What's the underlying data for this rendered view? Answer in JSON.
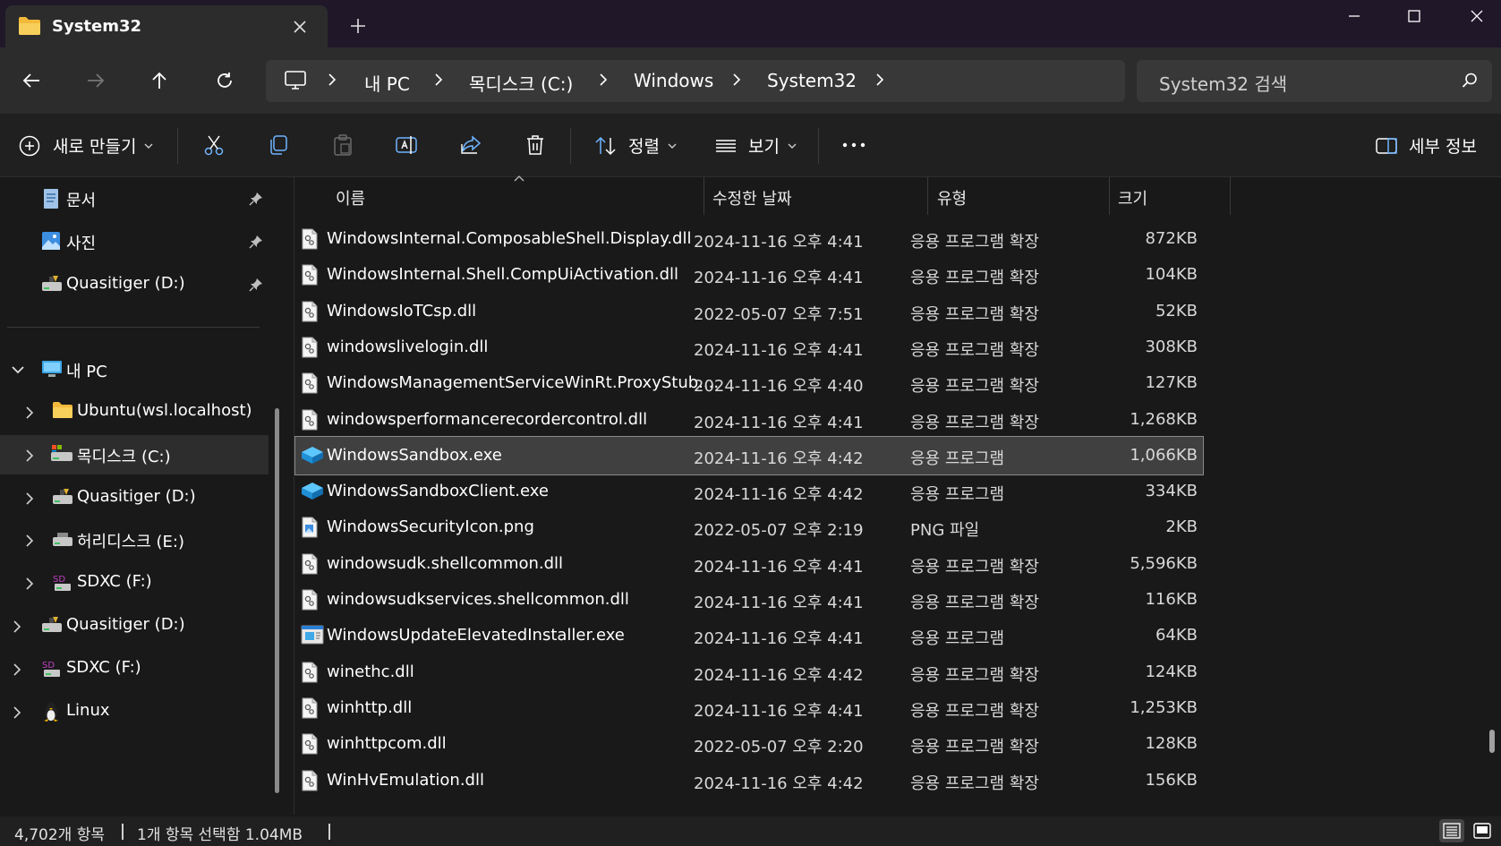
{
  "window": {
    "tab_title": "System32",
    "colors": {
      "titlebar": "#201729",
      "toolbar": "#2c2c2c",
      "selection": "#404040",
      "folder": "#f8c94c",
      "sandbox": "#2aa7e8"
    }
  },
  "nav": {
    "back_icon": "arrow-left-icon",
    "forward_icon": "arrow-right-icon",
    "up_icon": "arrow-up-icon",
    "refresh_icon": "refresh-icon"
  },
  "breadcrumb": {
    "items": [
      "내 PC",
      "목디스크 (C:)",
      "Windows",
      "System32"
    ]
  },
  "search": {
    "placeholder": "System32 검색"
  },
  "commands": {
    "new": "새로 만들기",
    "sort": "정렬",
    "view": "보기",
    "details": "세부 정보"
  },
  "sidebar": {
    "quick": [
      {
        "label": "문서",
        "icon": "document-icon"
      },
      {
        "label": "사진",
        "icon": "pictures-icon"
      },
      {
        "label": "Quasitiger (D:)",
        "icon": "drive-icon"
      }
    ],
    "this_pc": "내 PC",
    "pc_items": [
      {
        "label": "Ubuntu(wsl.localhost)",
        "icon": "folder-icon"
      },
      {
        "label": "목디스크 (C:)",
        "icon": "drive-icon"
      },
      {
        "label": "Quasitiger (D:)",
        "icon": "drive-icon"
      },
      {
        "label": "허리디스크 (E:)",
        "icon": "drive-icon"
      },
      {
        "label": "SDXC (F:)",
        "icon": "sd-card-icon"
      }
    ],
    "root_items": [
      {
        "label": "Quasitiger (D:)",
        "icon": "drive-icon"
      },
      {
        "label": "SDXC (F:)",
        "icon": "sd-card-icon"
      },
      {
        "label": "Linux",
        "icon": "linux-icon"
      }
    ]
  },
  "columns": {
    "name": "이름",
    "date": "수정한 날짜",
    "type": "유형",
    "size": "크기"
  },
  "files": [
    {
      "name": "WindowsInternal.ComposableShell.Display.dll",
      "date": "2024-11-16 오후 4:41",
      "type": "응용 프로그램 확장",
      "size": "872KB",
      "icon": "dll-icon"
    },
    {
      "name": "WindowsInternal.Shell.CompUiActivation.dll",
      "date": "2024-11-16 오후 4:41",
      "type": "응용 프로그램 확장",
      "size": "104KB",
      "icon": "dll-icon"
    },
    {
      "name": "WindowsIoTCsp.dll",
      "date": "2022-05-07 오후 7:51",
      "type": "응용 프로그램 확장",
      "size": "52KB",
      "icon": "dll-icon"
    },
    {
      "name": "windowslivelogin.dll",
      "date": "2024-11-16 오후 4:41",
      "type": "응용 프로그램 확장",
      "size": "308KB",
      "icon": "dll-icon"
    },
    {
      "name": "WindowsManagementServiceWinRt.ProxyStub....",
      "date": "2024-11-16 오후 4:40",
      "type": "응용 프로그램 확장",
      "size": "127KB",
      "icon": "dll-icon"
    },
    {
      "name": "windowsperformancerecordercontrol.dll",
      "date": "2024-11-16 오후 4:41",
      "type": "응용 프로그램 확장",
      "size": "1,268KB",
      "icon": "dll-icon"
    },
    {
      "name": "WindowsSandbox.exe",
      "date": "2024-11-16 오후 4:42",
      "type": "응용 프로그램",
      "size": "1,066KB",
      "icon": "sandbox-icon",
      "selected": true
    },
    {
      "name": "WindowsSandboxClient.exe",
      "date": "2024-11-16 오후 4:42",
      "type": "응용 프로그램",
      "size": "334KB",
      "icon": "sandbox-icon"
    },
    {
      "name": "WindowsSecurityIcon.png",
      "date": "2022-05-07 오후 2:19",
      "type": "PNG 파일",
      "size": "2KB",
      "icon": "png-icon"
    },
    {
      "name": "windowsudk.shellcommon.dll",
      "date": "2024-11-16 오후 4:41",
      "type": "응용 프로그램 확장",
      "size": "5,596KB",
      "icon": "dll-icon"
    },
    {
      "name": "windowsudkservices.shellcommon.dll",
      "date": "2024-11-16 오후 4:41",
      "type": "응용 프로그램 확장",
      "size": "116KB",
      "icon": "dll-icon"
    },
    {
      "name": "WindowsUpdateElevatedInstaller.exe",
      "date": "2024-11-16 오후 4:41",
      "type": "응용 프로그램",
      "size": "64KB",
      "icon": "installer-icon"
    },
    {
      "name": "winethc.dll",
      "date": "2024-11-16 오후 4:42",
      "type": "응용 프로그램 확장",
      "size": "124KB",
      "icon": "dll-icon"
    },
    {
      "name": "winhttp.dll",
      "date": "2024-11-16 오후 4:41",
      "type": "응용 프로그램 확장",
      "size": "1,253KB",
      "icon": "dll-icon"
    },
    {
      "name": "winhttpcom.dll",
      "date": "2022-05-07 오후 2:20",
      "type": "응용 프로그램 확장",
      "size": "128KB",
      "icon": "dll-icon"
    },
    {
      "name": "WinHvEmulation.dll",
      "date": "2024-11-16 오후 4:42",
      "type": "응용 프로그램 확장",
      "size": "156KB",
      "icon": "dll-icon"
    }
  ],
  "status": {
    "count": "4,702개 항목",
    "selection": "1개 항목 선택함 1.04MB"
  }
}
